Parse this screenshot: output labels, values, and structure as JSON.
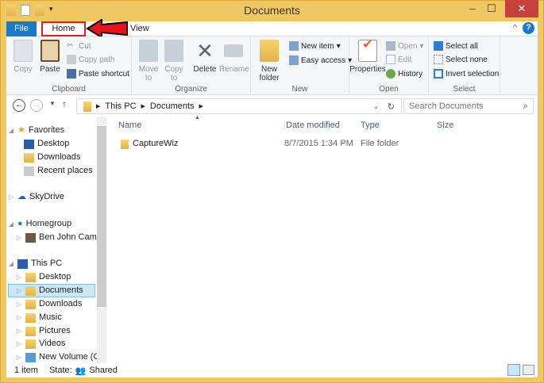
{
  "window": {
    "title": "Documents",
    "colors": {
      "frame": "#f0c862",
      "file_tab": "#1979ca",
      "highlight": "#e02020",
      "close": "#c7403a"
    }
  },
  "tabs": {
    "file": "File",
    "home": "Home",
    "view": "View"
  },
  "ribbon": {
    "clipboard": {
      "label": "Clipboard",
      "copy": "Copy",
      "paste": "Paste",
      "cut": "Cut",
      "copy_path": "Copy path",
      "paste_shortcut": "Paste shortcut"
    },
    "organize": {
      "label": "Organize",
      "move_to": "Move to",
      "copy_to": "Copy to",
      "delete": "Delete",
      "rename": "Rename"
    },
    "new": {
      "label": "New",
      "new_folder": "New folder",
      "new_item": "New item",
      "easy_access": "Easy access"
    },
    "open": {
      "label": "Open",
      "properties": "Properties",
      "open": "Open",
      "edit": "Edit",
      "history": "History"
    },
    "select": {
      "label": "Select",
      "select_all": "Select all",
      "select_none": "Select none",
      "invert": "Invert selection"
    }
  },
  "address": {
    "crumbs": [
      "This PC",
      "Documents"
    ],
    "search_placeholder": "Search Documents"
  },
  "nav": {
    "favorites": "Favorites",
    "fav_items": [
      "Desktop",
      "Downloads",
      "Recent places"
    ],
    "skydrive": "SkyDrive",
    "homegroup": "Homegroup",
    "homegroup_user": "Ben John Campo",
    "this_pc": "This PC",
    "pc_items": [
      "Desktop",
      "Documents",
      "Downloads",
      "Music",
      "Pictures",
      "Videos",
      "New Volume (C:)"
    ]
  },
  "columns": [
    "Name",
    "Date modified",
    "Type",
    "Size"
  ],
  "files": [
    {
      "name": "CaptureWiz",
      "date": "8/7/2015 1:34 PM",
      "type": "File folder",
      "size": ""
    }
  ],
  "status": {
    "count": "1 item",
    "state_label": "State:",
    "state": "Shared"
  }
}
